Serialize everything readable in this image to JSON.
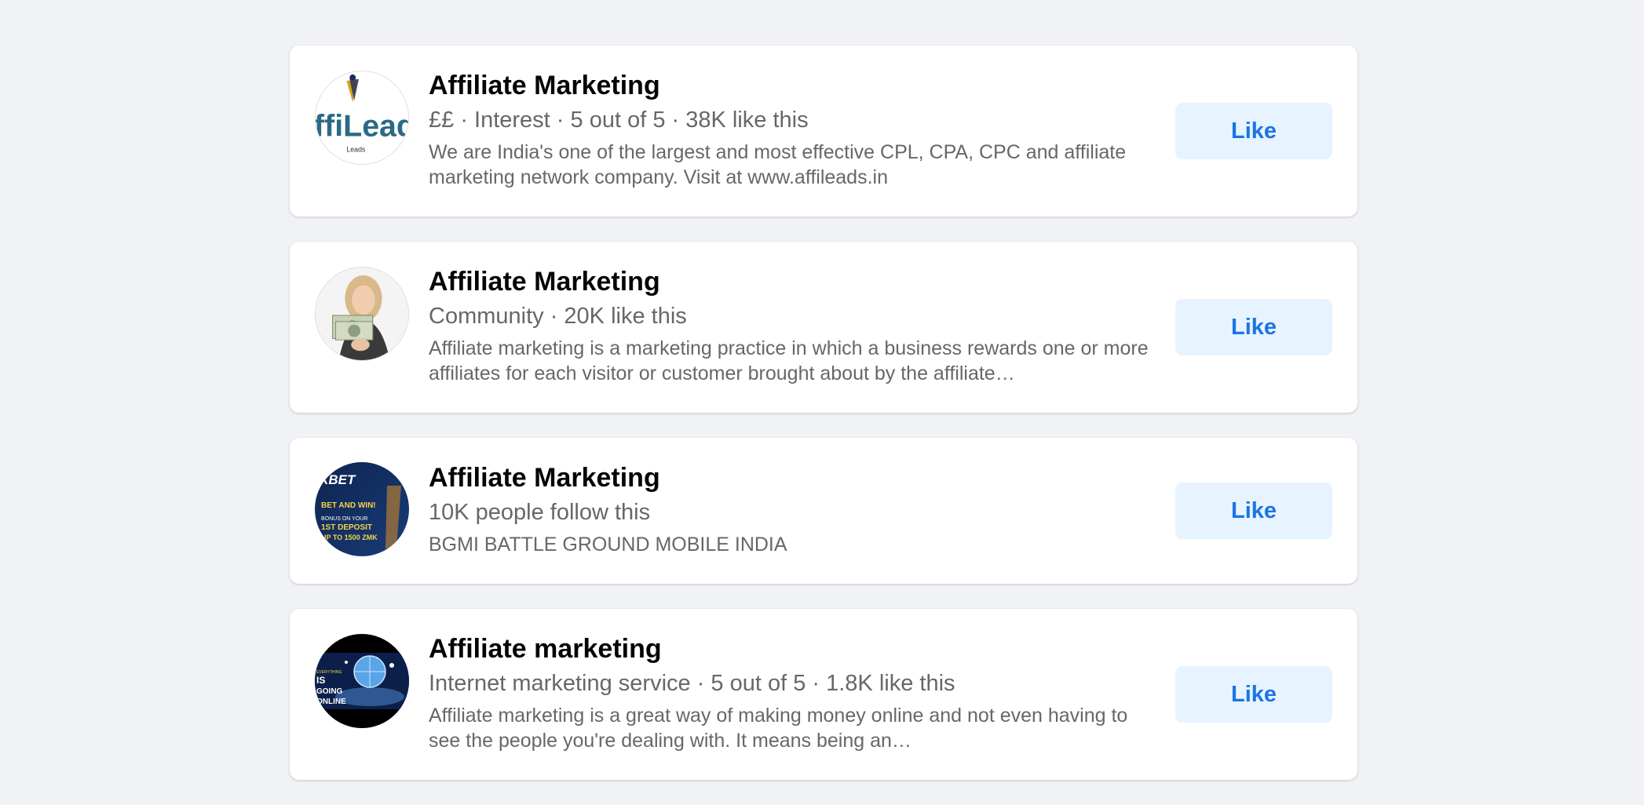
{
  "results": [
    {
      "avatar_icon": "affileads-logo",
      "avatar_text": "ffiLeads",
      "title": "Affiliate Marketing",
      "meta": "££ · Interest · 5 out of 5 · 38K like this",
      "description": "We are India's one of the largest and most effective CPL, CPA, CPC and affiliate marketing network company. Visit at www.affileads.in",
      "button_label": "Like"
    },
    {
      "avatar_icon": "person-with-money-photo",
      "title": "Affiliate Marketing",
      "meta": "Community · 20K like this",
      "description": "Affiliate marketing is a marketing practice in which a business rewards one or more affiliates for each visitor or customer brought about by the affiliate…",
      "button_label": "Like"
    },
    {
      "avatar_icon": "1xbet-promo-image",
      "avatar_lines": [
        "XBET",
        "BET AND WIN!",
        "BONUS ON YOUR",
        "1ST DEPOSIT",
        "UP TO 1500 ZMK"
      ],
      "title": "Affiliate Marketing",
      "meta": "10K people follow this",
      "description": "BGMI BATTLE GROUND MOBILE INDIA",
      "button_label": "Like"
    },
    {
      "avatar_icon": "globe-everything-online-image",
      "avatar_lines": [
        "EVERYTHING",
        "IS",
        "GOING",
        "ONLINE"
      ],
      "title": "Affiliate marketing",
      "meta": "Internet marketing service · 5 out of 5 · 1.8K like this",
      "description": "Affiliate marketing is a great way of making money online and not even having to see the people you're dealing with. It means being an…",
      "button_label": "Like"
    }
  ],
  "colors": {
    "page_background": "#f0f2f5",
    "card_background": "#ffffff",
    "title": "#050505",
    "secondary_text": "#65676b",
    "like_button_bg": "#e7f3ff",
    "like_button_text": "#1b74e4"
  }
}
